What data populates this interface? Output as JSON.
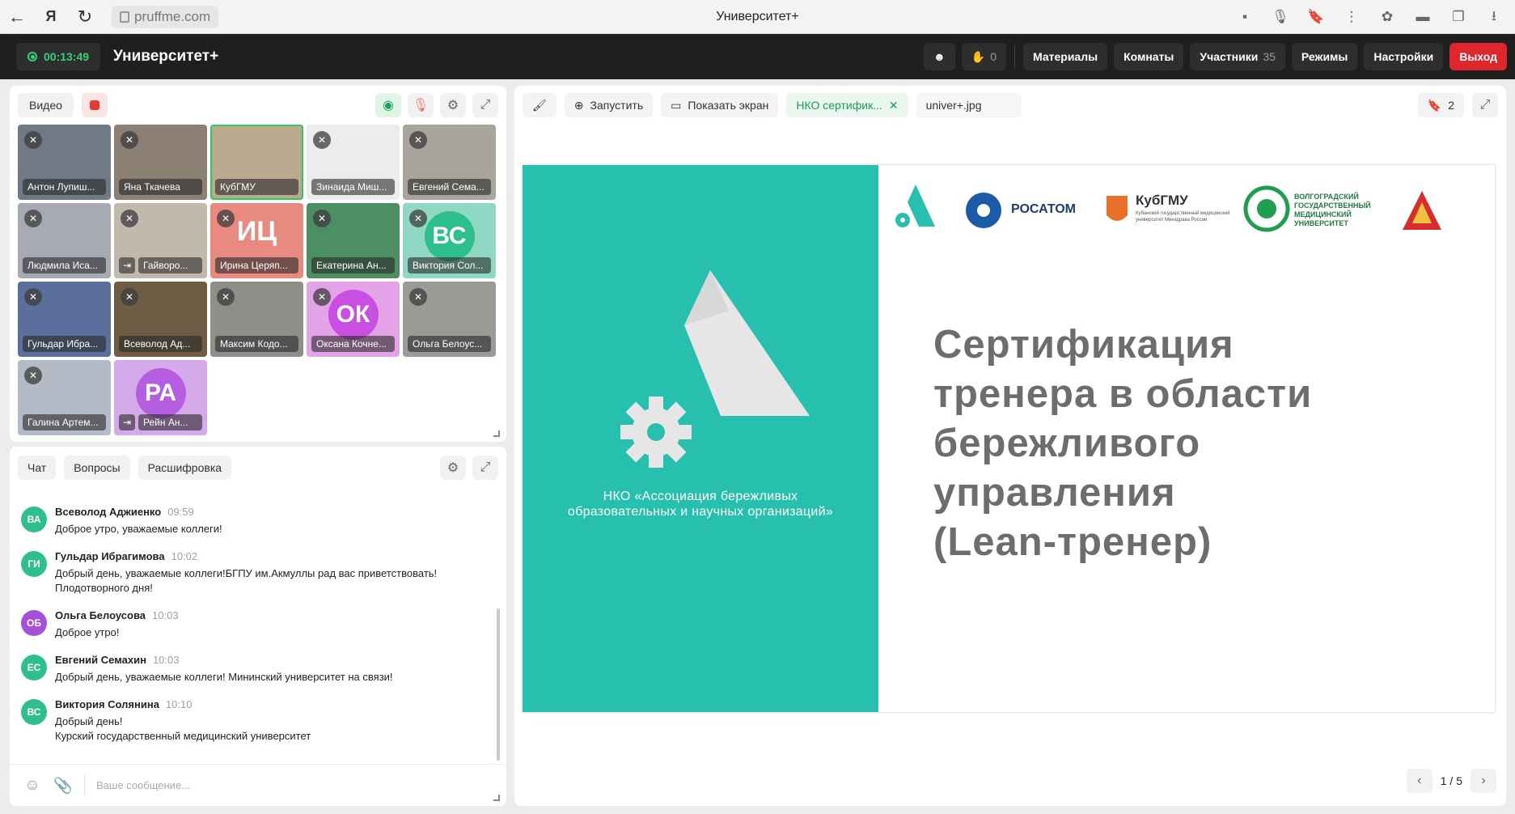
{
  "browser": {
    "url": "pruffme.com",
    "tab_title": "Университет+"
  },
  "header": {
    "timer": "00:13:49",
    "title": "Университет+",
    "raised_hands": "0",
    "materials": "Материалы",
    "rooms": "Комнаты",
    "participants": "Участники",
    "participants_count": "35",
    "modes": "Режимы",
    "settings": "Настройки",
    "exit": "Выход"
  },
  "video": {
    "video_label": "Видео",
    "tiles": [
      {
        "name": "Антон Лупиш...",
        "bg": "#6f7a86",
        "muted": true
      },
      {
        "name": "Яна Ткачева",
        "bg": "#8c7f74",
        "muted": true
      },
      {
        "name": "КубГМУ",
        "bg": "#b9a98e",
        "muted": false,
        "active": true
      },
      {
        "name": "Зинаида Миш...",
        "bg": "#ececec",
        "muted": true
      },
      {
        "name": "Евгений Сема...",
        "bg": "#a8a49b",
        "muted": true
      },
      {
        "name": "Людмила Иса...",
        "bg": "#a7aab2",
        "muted": true
      },
      {
        "name": "Гайворо...",
        "bg": "#c2b9ad",
        "muted": true,
        "exit": true
      },
      {
        "name": "Ирина Церяп...",
        "bg": "#e88a7f",
        "muted": true,
        "initials": "ИЦ"
      },
      {
        "name": "Екатерина Ан...",
        "bg": "#4b8f63",
        "muted": true
      },
      {
        "name": "Виктория Сол...",
        "bg": "#8fd9c4",
        "muted": true,
        "circle": "ВС",
        "circle_color": "#2fbf8c"
      },
      {
        "name": "Гульдар Ибра...",
        "bg": "#5b6f9c",
        "muted": true
      },
      {
        "name": "Всеволод Ад...",
        "bg": "#6e5c44",
        "muted": true
      },
      {
        "name": "Максим Кодо...",
        "bg": "#8e8e8a",
        "muted": true
      },
      {
        "name": "Оксана Кочне...",
        "bg": "#e3a3e7",
        "muted": true,
        "circle": "ОК",
        "circle_color": "#c94ee2"
      },
      {
        "name": "Ольга Белоус...",
        "bg": "#9b9a96",
        "muted": true
      },
      {
        "name": "Галина Артем...",
        "bg": "#b4bac6",
        "muted": true
      },
      {
        "name": "Рейн Ан...",
        "bg": "#d6a9eb",
        "muted": false,
        "exit": true,
        "circle": "РА",
        "circle_color": "#b55ee0"
      }
    ]
  },
  "chat": {
    "tabs": [
      "Чат",
      "Вопросы",
      "Расшифровка"
    ],
    "messages": [
      {
        "initials": "ВА",
        "color": "#2fbf8c",
        "author": "Всеволод Аджиенко",
        "time": "09:59",
        "text": "Доброе утро, уважаемые коллеги!"
      },
      {
        "initials": "ГИ",
        "color": "#2fbf8c",
        "author": "Гульдар Ибрагимова",
        "time": "10:02",
        "text": "Добрый день, уважаемые коллеги!БГПУ им.Акмуллы рад вас приветствовать!\nПлодотворного дня!"
      },
      {
        "initials": "ОБ",
        "color": "#a64fd8",
        "author": "Ольга Белоусова",
        "time": "10:03",
        "text": "Доброе утро!"
      },
      {
        "initials": "ЕС",
        "color": "#2fbf8c",
        "author": "Евгений Семахин",
        "time": "10:03",
        "text": "Добрый день, уважаемые коллеги! Мининский университет на связи!"
      },
      {
        "initials": "ВС",
        "color": "#2fbf8c",
        "author": "Виктория Солянина",
        "time": "10:10",
        "text": "Добрый день!\nКурский государственный медицинский университет"
      }
    ],
    "placeholder": "Ваше сообщение..."
  },
  "presentation": {
    "launch": "Запустить",
    "share_screen": "Показать экран",
    "file_active": "НКО сертифик...",
    "file_second": "univer+.jpg",
    "bookmarks": "2",
    "slide": {
      "org_line1": "НКО «Ассоциация бережливых",
      "org_line2": "образовательных и научных организаций»",
      "title": "Сертификация\nтренера в области\nбережливого\nуправления\n(Lean-тренер)",
      "logo_rosatom": "РОСАТОМ",
      "logo_kubgmu": "КубГМУ",
      "logo_kubgmu_sub": "Кубанский государственный медицинский университет Минздрава России",
      "logo_volg": "ВОЛГОГРАДСКИЙ ГОСУДАРСТВЕННЫЙ МЕДИЦИНСКИЙ УНИВЕРСИТЕТ"
    },
    "page": "1 / 5"
  }
}
